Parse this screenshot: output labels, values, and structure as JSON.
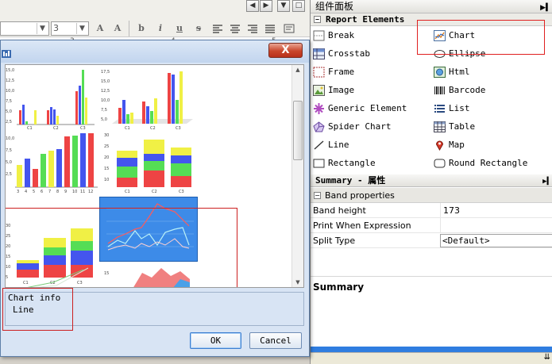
{
  "editor": {
    "font_name_value": "",
    "font_size_value": "3",
    "format_glyphs": [
      "A",
      "A",
      "b",
      "i",
      "u",
      "s"
    ],
    "ruler_marks": [
      "3",
      "4",
      "5"
    ]
  },
  "palette": {
    "title": "组件面板",
    "section": "Report Elements",
    "items": [
      {
        "label": "Break",
        "icon": "break-icon"
      },
      {
        "label": "Chart",
        "icon": "chart-icon"
      },
      {
        "label": "Crosstab",
        "icon": "crosstab-icon"
      },
      {
        "label": "Ellipse",
        "icon": "ellipse-icon"
      },
      {
        "label": "Frame",
        "icon": "frame-icon"
      },
      {
        "label": "Html",
        "icon": "html-icon"
      },
      {
        "label": "Image",
        "icon": "image-icon"
      },
      {
        "label": "Barcode",
        "icon": "barcode-icon"
      },
      {
        "label": "Generic Element",
        "icon": "generic-element-icon"
      },
      {
        "label": "List",
        "icon": "list-icon"
      },
      {
        "label": "Spider Chart",
        "icon": "spider-chart-icon"
      },
      {
        "label": "Table",
        "icon": "table-icon"
      },
      {
        "label": "Line",
        "icon": "line-icon"
      },
      {
        "label": "Map",
        "icon": "map-icon"
      },
      {
        "label": "Rectangle",
        "icon": "rectangle-icon"
      },
      {
        "label": "Round Rectangle",
        "icon": "round-rectangle-icon"
      }
    ]
  },
  "properties": {
    "title": "Summary - 属性",
    "band_section": "Band properties",
    "rows": [
      {
        "key": "Band height",
        "value": "173"
      },
      {
        "key": "Print When Expression",
        "value": ""
      },
      {
        "key": "Split Type",
        "value": "<Default>"
      }
    ],
    "summary_heading": "Summary"
  },
  "dialog": {
    "close_glyph": "X",
    "info_label": "Chart info",
    "info_value": "Line",
    "ok_label": "OK",
    "cancel_label": "Cancel",
    "selected_thumbnail": "line chart"
  },
  "colors": {
    "bar_red": "#ee4444",
    "bar_green": "#55dd55",
    "bar_blue": "#4455ee",
    "bar_yellow": "#f0f045",
    "selection_blue": "#3d8be8",
    "annotation_red": "#e02020"
  }
}
